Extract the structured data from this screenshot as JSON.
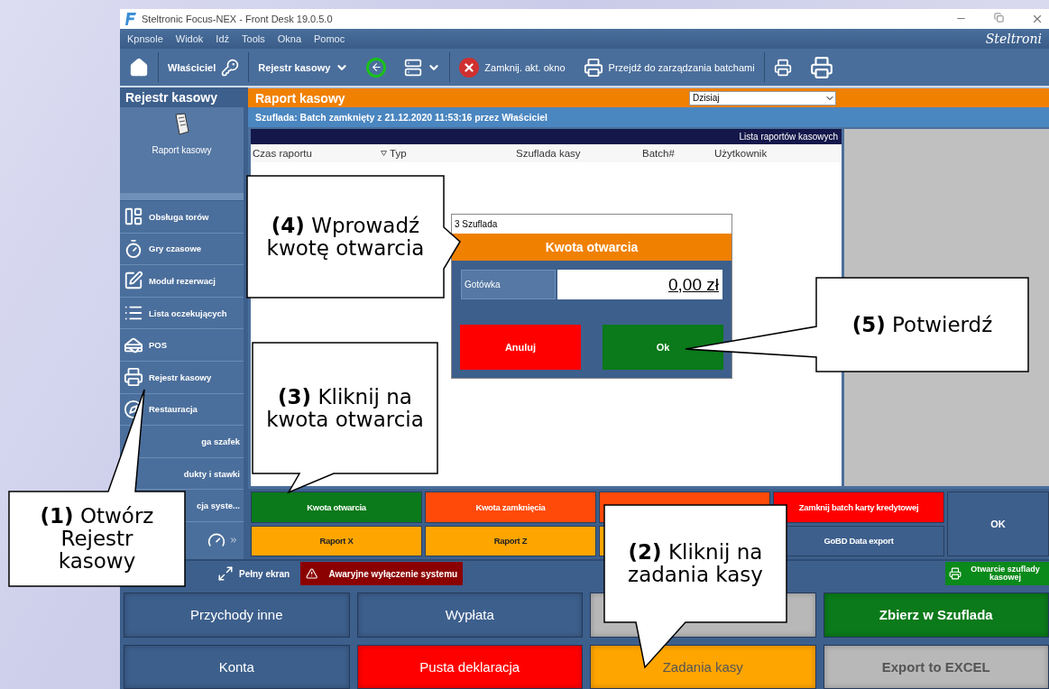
{
  "window": {
    "title": "Steltronic Focus-NEX - Front Desk 19.0.5.0"
  },
  "menu": [
    "Kpnsole",
    "Widok",
    "Idź",
    "Tools",
    "Okna",
    "Pomoc"
  ],
  "logo": "Steltroni",
  "toolbar": {
    "user": "Właściciel",
    "module": "Rejestr kasowy",
    "close_label": "Zamknij. akt. okno",
    "batch_label": "Przejdź do zarządzania batchami"
  },
  "sidebar": {
    "title": "Rejestr kasowy",
    "shortcut": "Raport kasowy",
    "items": [
      {
        "label": "Obsługa torów",
        "kind": "full"
      },
      {
        "label": "Gry czasowe",
        "kind": "full"
      },
      {
        "label": "Moduł rezerwacj",
        "kind": "full"
      },
      {
        "label": "Lista oczekujących",
        "kind": "full"
      },
      {
        "label": "POS",
        "kind": "full"
      },
      {
        "label": "Rejestr kasowy",
        "kind": "full"
      },
      {
        "label": "Restauracja",
        "kind": "full"
      },
      {
        "label": "ga szafek",
        "kind": "clipped"
      },
      {
        "label": "dukty i stawki",
        "kind": "clipped"
      },
      {
        "label": "cja syste...",
        "kind": "clipped"
      }
    ]
  },
  "report": {
    "title": "Raport kasowy",
    "period": "Dzisiaj",
    "status": "Szuflada: Batch zamknięty z 21.12.2020 11:53:16 przez Właściciel",
    "list_title": "Lista raportów kasowych",
    "columns": [
      {
        "label": "Czas raportu",
        "sorted": false
      },
      {
        "label": "Typ",
        "sorted": true
      },
      {
        "label": "Szuflada kasy",
        "sorted": false
      },
      {
        "label": "Batch#",
        "sorted": false
      },
      {
        "label": "Użytkownik",
        "sorted": false
      }
    ]
  },
  "tasks": [
    {
      "label": "Kwota otwarcia",
      "color": "#0a7a1a"
    },
    {
      "label": "Kwota zamknięcia",
      "color": "#ff4a0a"
    },
    {
      "color": "#ff4a0a"
    },
    {
      "label": "Zamknij batch karty kredytowej",
      "color": "#ff0000"
    },
    {
      "label": "Raport X",
      "color": "#ffa500"
    },
    {
      "label": "Raport Z",
      "color": "#ffa500"
    },
    {
      "color": "#ffa500"
    },
    {
      "label": "GoBD Data export",
      "color": "#3d5f8c"
    }
  ],
  "ok": "OK",
  "status_bar": {
    "fullscreen": "Pełny ekran",
    "emergency": "Awaryjne wyłączenie systemu",
    "drawer": "Otwarcie szuflady kasowej"
  },
  "actions": [
    {
      "label": "Przychody inne",
      "color": "#3d5f8c",
      "bold": false
    },
    {
      "label": "Wypłata",
      "color": "#3d5f8c",
      "bold": false
    },
    {
      "color": "#b8b8b8"
    },
    {
      "label": "Zbierz w Szuflada",
      "color": "#0a7a1a",
      "bold": true
    },
    {
      "label": "Konta",
      "color": "#3d5f8c",
      "bold": false
    },
    {
      "label": "Pusta deklaracja",
      "color": "#ff0000",
      "bold": false
    },
    {
      "label": "Zadania kasy",
      "color": "#ffa500",
      "bold": false
    },
    {
      "label": "Export to EXCEL",
      "color": "#b8b8b8",
      "bold": true
    }
  ],
  "dialog": {
    "title": "3 Szuflada",
    "header": "Kwota otwarcia",
    "field_label": "Gotówka",
    "value": "0,00 zł",
    "buttons": [
      {
        "label": "Anuluj",
        "color": "#ff0000"
      },
      {
        "label": "Ok",
        "color": "#0a7a1a"
      }
    ]
  },
  "callouts": [
    {
      "text": "**(4)** Wprowadź kwotę otwarcia"
    },
    {
      "text": "**(5)** Potwierdź"
    },
    {
      "text": "**(3)** Kliknij na kwota otwarcia"
    },
    {
      "text": "**(1)** Otwórz Rejestr kasowy"
    },
    {
      "text": "**(2)** Kliknij na zadania kasy"
    }
  ]
}
